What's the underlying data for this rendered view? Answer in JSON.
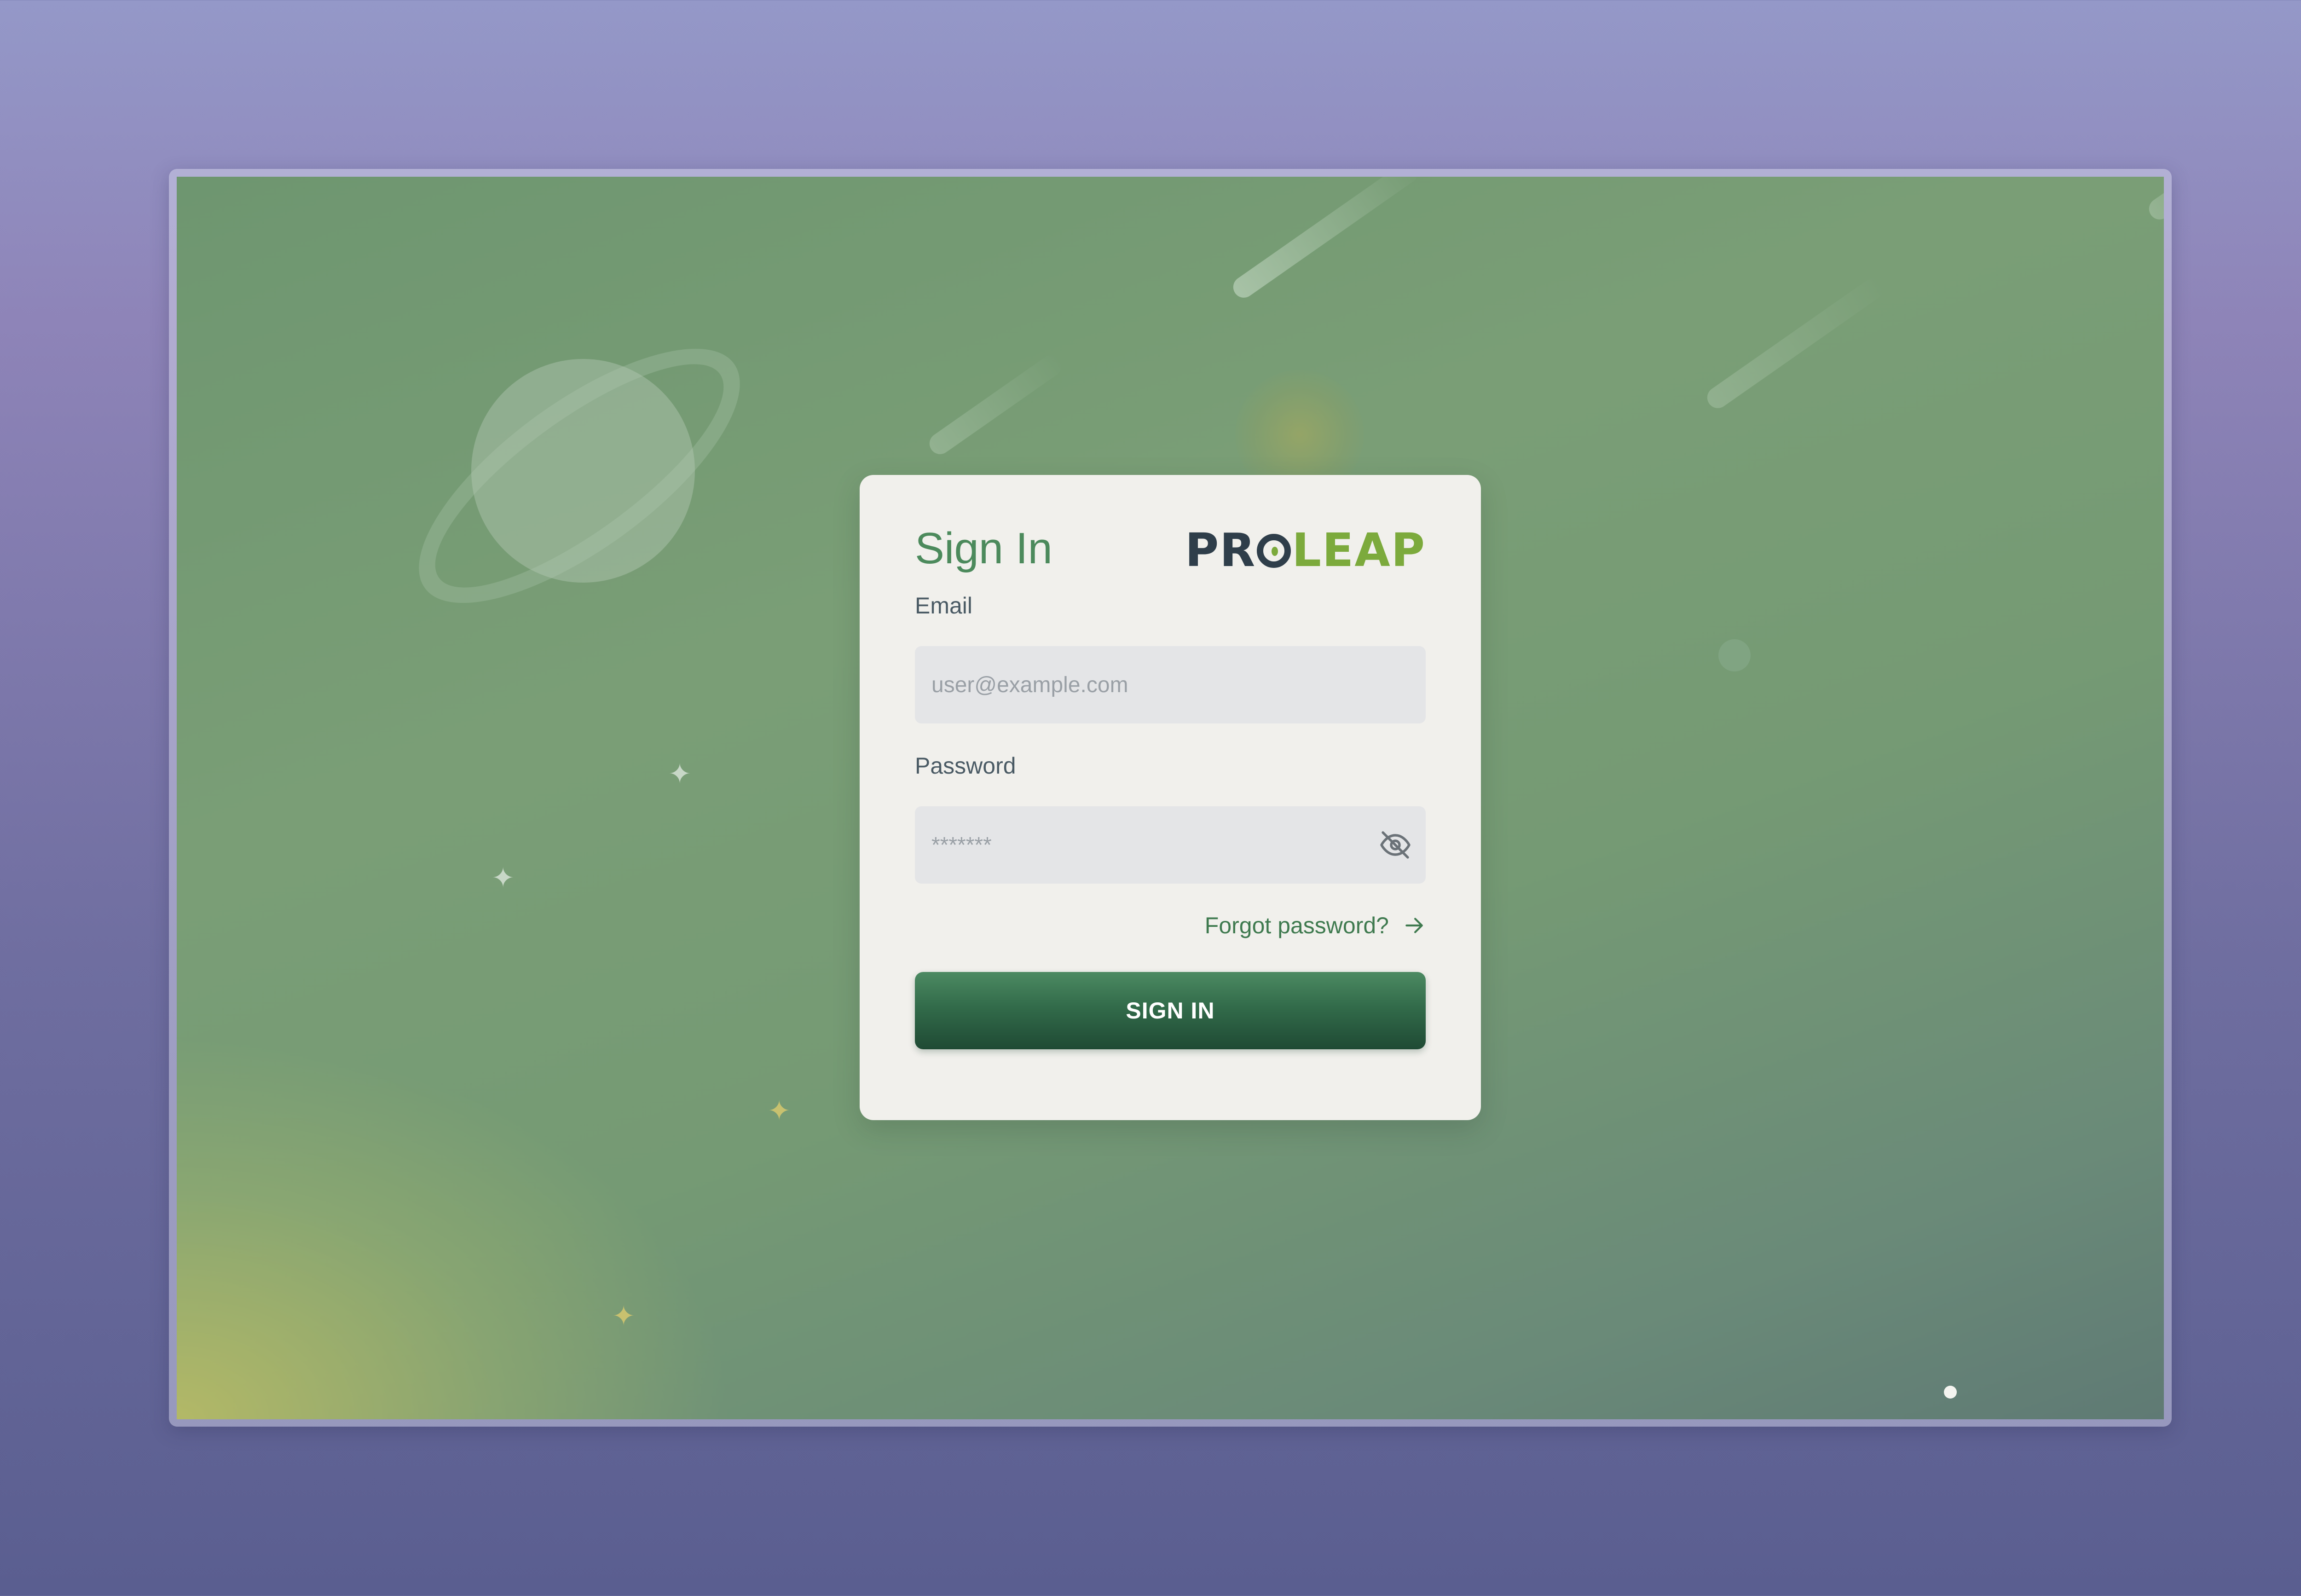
{
  "signin": {
    "title": "Sign In",
    "logo": {
      "pro": "PR",
      "leap": "LEAP"
    },
    "email": {
      "label": "Email",
      "placeholder": "user@example.com",
      "value": ""
    },
    "password": {
      "label": "Password",
      "placeholder": "*******",
      "value": ""
    },
    "forgot_password": "Forgot password?",
    "submit_label": "SIGN IN"
  },
  "icons": {
    "password_toggle": "eye-off-icon",
    "forgot_arrow": "arrow-right-icon"
  },
  "colors": {
    "accent_green": "#4c8a5c",
    "button_top": "#4c8a62",
    "button_bottom": "#1f4a34",
    "card_background": "#f1f0ec",
    "input_background": "#e4e5e7",
    "logo_dark": "#2f3e4a",
    "logo_green": "#7caa3c"
  }
}
